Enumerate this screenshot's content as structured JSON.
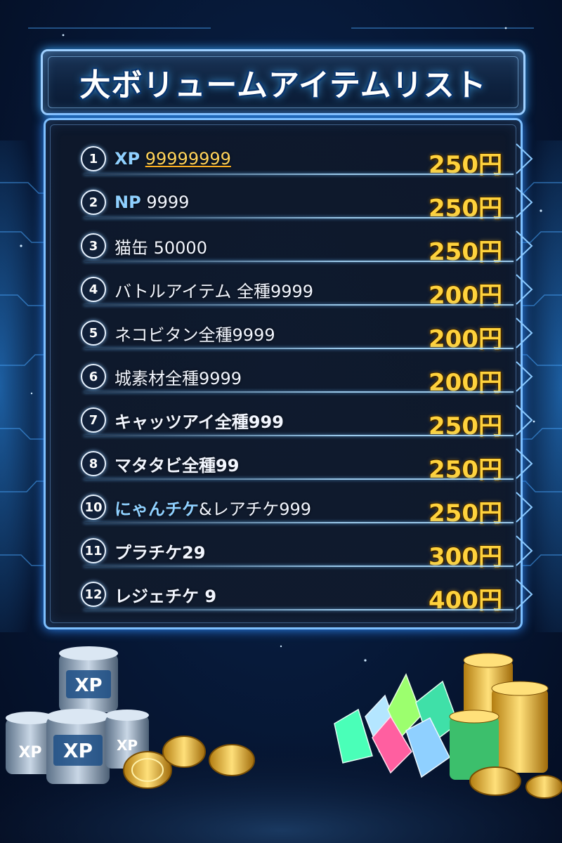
{
  "title": "大ボリュームアイテムリスト",
  "items": [
    {
      "num": "1",
      "label_accent": "XP",
      "label_gold": "99999999",
      "label": "",
      "price": "250円"
    },
    {
      "num": "2",
      "label_accent": "NP",
      "label_gold": "",
      "label": "9999",
      "price": "250円"
    },
    {
      "num": "3",
      "label_accent": "",
      "label_gold": "",
      "label": "猫缶 50000",
      "price": "250円"
    },
    {
      "num": "4",
      "label_accent": "",
      "label_gold": "",
      "label": "バトルアイテム 全種9999",
      "price": "200円"
    },
    {
      "num": "5",
      "label_accent": "",
      "label_gold": "",
      "label": "ネコビタン全種9999",
      "price": "200円"
    },
    {
      "num": "6",
      "label_accent": "",
      "label_gold": "",
      "label": "城素材全種9999",
      "price": "200円"
    },
    {
      "num": "7",
      "label_accent": "",
      "label_gold": "",
      "label": "キャッツアイ全種999",
      "price": "250円"
    },
    {
      "num": "8",
      "label_accent": "",
      "label_gold": "",
      "label": "マタタビ全種99",
      "price": "250円"
    },
    {
      "num": "10",
      "label_accent": "にゃんチケ",
      "label_gold": "",
      "label": "&レアチケ999",
      "price": "250円"
    },
    {
      "num": "11",
      "label_accent": "",
      "label_gold": "",
      "label": "プラチケ29",
      "price": "300円"
    },
    {
      "num": "12",
      "label_accent": "",
      "label_gold": "",
      "label": "レジェチケ 9",
      "price": "400円"
    }
  ],
  "decor": {
    "left_pile_text": "XP",
    "icons": [
      "xp-can-icon",
      "gold-coin-icon",
      "gem-crystal-icon"
    ]
  },
  "colors": {
    "price": "#ffd23c",
    "accent": "#8fd0ff",
    "frame": "#7dbfff",
    "background": "#071a3a"
  }
}
